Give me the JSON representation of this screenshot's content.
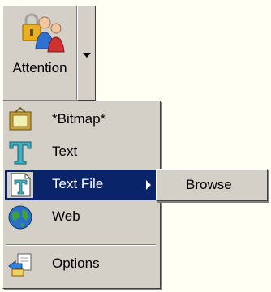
{
  "toolbar": {
    "attention_label": "Attention",
    "attention_icon": "users-lock-icon"
  },
  "menu": {
    "items": [
      {
        "label": "*Bitmap*",
        "icon": "picture-frame-icon"
      },
      {
        "label": "Text",
        "icon": "text-t-icon"
      },
      {
        "label": "Text File",
        "icon": "text-file-icon",
        "selected": true
      },
      {
        "label": "Web",
        "icon": "globe-icon"
      },
      {
        "label": "Options",
        "icon": "options-icon"
      }
    ]
  },
  "submenu": {
    "items": [
      {
        "label": "Browse"
      }
    ]
  },
  "colors": {
    "selection": "#0a246a",
    "face": "#d4d0c8"
  }
}
